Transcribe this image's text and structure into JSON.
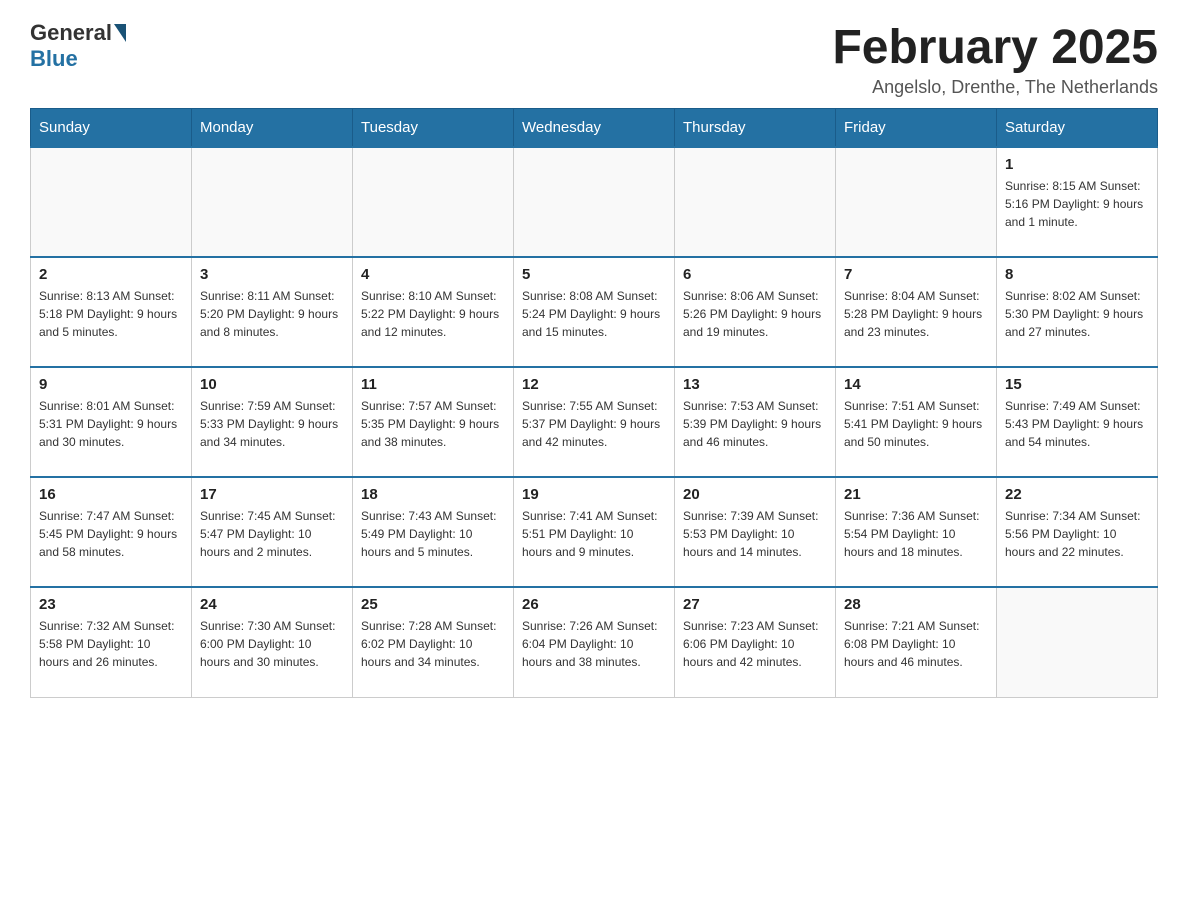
{
  "header": {
    "logo": {
      "general": "General",
      "blue": "Blue"
    },
    "title": "February 2025",
    "location": "Angelslo, Drenthe, The Netherlands"
  },
  "days_of_week": [
    "Sunday",
    "Monday",
    "Tuesday",
    "Wednesday",
    "Thursday",
    "Friday",
    "Saturday"
  ],
  "weeks": [
    [
      {
        "day": "",
        "info": ""
      },
      {
        "day": "",
        "info": ""
      },
      {
        "day": "",
        "info": ""
      },
      {
        "day": "",
        "info": ""
      },
      {
        "day": "",
        "info": ""
      },
      {
        "day": "",
        "info": ""
      },
      {
        "day": "1",
        "info": "Sunrise: 8:15 AM\nSunset: 5:16 PM\nDaylight: 9 hours and 1 minute."
      }
    ],
    [
      {
        "day": "2",
        "info": "Sunrise: 8:13 AM\nSunset: 5:18 PM\nDaylight: 9 hours and 5 minutes."
      },
      {
        "day": "3",
        "info": "Sunrise: 8:11 AM\nSunset: 5:20 PM\nDaylight: 9 hours and 8 minutes."
      },
      {
        "day": "4",
        "info": "Sunrise: 8:10 AM\nSunset: 5:22 PM\nDaylight: 9 hours and 12 minutes."
      },
      {
        "day": "5",
        "info": "Sunrise: 8:08 AM\nSunset: 5:24 PM\nDaylight: 9 hours and 15 minutes."
      },
      {
        "day": "6",
        "info": "Sunrise: 8:06 AM\nSunset: 5:26 PM\nDaylight: 9 hours and 19 minutes."
      },
      {
        "day": "7",
        "info": "Sunrise: 8:04 AM\nSunset: 5:28 PM\nDaylight: 9 hours and 23 minutes."
      },
      {
        "day": "8",
        "info": "Sunrise: 8:02 AM\nSunset: 5:30 PM\nDaylight: 9 hours and 27 minutes."
      }
    ],
    [
      {
        "day": "9",
        "info": "Sunrise: 8:01 AM\nSunset: 5:31 PM\nDaylight: 9 hours and 30 minutes."
      },
      {
        "day": "10",
        "info": "Sunrise: 7:59 AM\nSunset: 5:33 PM\nDaylight: 9 hours and 34 minutes."
      },
      {
        "day": "11",
        "info": "Sunrise: 7:57 AM\nSunset: 5:35 PM\nDaylight: 9 hours and 38 minutes."
      },
      {
        "day": "12",
        "info": "Sunrise: 7:55 AM\nSunset: 5:37 PM\nDaylight: 9 hours and 42 minutes."
      },
      {
        "day": "13",
        "info": "Sunrise: 7:53 AM\nSunset: 5:39 PM\nDaylight: 9 hours and 46 minutes."
      },
      {
        "day": "14",
        "info": "Sunrise: 7:51 AM\nSunset: 5:41 PM\nDaylight: 9 hours and 50 minutes."
      },
      {
        "day": "15",
        "info": "Sunrise: 7:49 AM\nSunset: 5:43 PM\nDaylight: 9 hours and 54 minutes."
      }
    ],
    [
      {
        "day": "16",
        "info": "Sunrise: 7:47 AM\nSunset: 5:45 PM\nDaylight: 9 hours and 58 minutes."
      },
      {
        "day": "17",
        "info": "Sunrise: 7:45 AM\nSunset: 5:47 PM\nDaylight: 10 hours and 2 minutes."
      },
      {
        "day": "18",
        "info": "Sunrise: 7:43 AM\nSunset: 5:49 PM\nDaylight: 10 hours and 5 minutes."
      },
      {
        "day": "19",
        "info": "Sunrise: 7:41 AM\nSunset: 5:51 PM\nDaylight: 10 hours and 9 minutes."
      },
      {
        "day": "20",
        "info": "Sunrise: 7:39 AM\nSunset: 5:53 PM\nDaylight: 10 hours and 14 minutes."
      },
      {
        "day": "21",
        "info": "Sunrise: 7:36 AM\nSunset: 5:54 PM\nDaylight: 10 hours and 18 minutes."
      },
      {
        "day": "22",
        "info": "Sunrise: 7:34 AM\nSunset: 5:56 PM\nDaylight: 10 hours and 22 minutes."
      }
    ],
    [
      {
        "day": "23",
        "info": "Sunrise: 7:32 AM\nSunset: 5:58 PM\nDaylight: 10 hours and 26 minutes."
      },
      {
        "day": "24",
        "info": "Sunrise: 7:30 AM\nSunset: 6:00 PM\nDaylight: 10 hours and 30 minutes."
      },
      {
        "day": "25",
        "info": "Sunrise: 7:28 AM\nSunset: 6:02 PM\nDaylight: 10 hours and 34 minutes."
      },
      {
        "day": "26",
        "info": "Sunrise: 7:26 AM\nSunset: 6:04 PM\nDaylight: 10 hours and 38 minutes."
      },
      {
        "day": "27",
        "info": "Sunrise: 7:23 AM\nSunset: 6:06 PM\nDaylight: 10 hours and 42 minutes."
      },
      {
        "day": "28",
        "info": "Sunrise: 7:21 AM\nSunset: 6:08 PM\nDaylight: 10 hours and 46 minutes."
      },
      {
        "day": "",
        "info": ""
      }
    ]
  ]
}
